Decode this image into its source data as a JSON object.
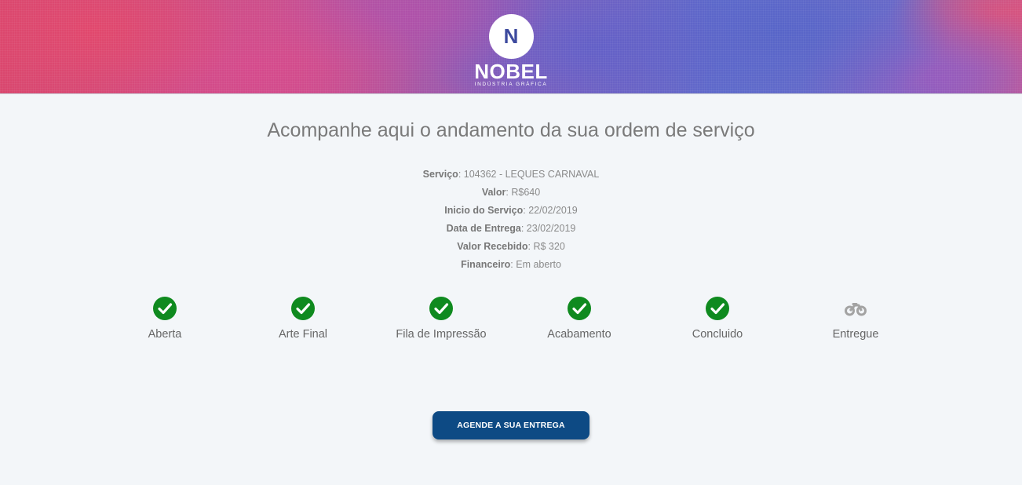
{
  "brand": {
    "logo_letter": "N",
    "name": "NOBEL",
    "subtitle": "INDÚSTRIA GRÁFICA"
  },
  "page_title": "Acompanhe aqui o andamento da sua ordem de serviço",
  "details": [
    {
      "label": "Serviço",
      "value": "104362 - LEQUES CARNAVAL"
    },
    {
      "label": "Valor",
      "value": "R$640"
    },
    {
      "label": "Inicio do Serviço",
      "value": "22/02/2019"
    },
    {
      "label": "Data de Entrega",
      "value": "23/02/2019"
    },
    {
      "label": "Valor Recebido",
      "value": "R$ 320"
    },
    {
      "label": "Financeiro",
      "value": "Em aberto"
    }
  ],
  "steps": [
    {
      "label": "Aberta",
      "icon": "check-circle-icon",
      "done": true
    },
    {
      "label": "Arte Final",
      "icon": "check-circle-icon",
      "done": true
    },
    {
      "label": "Fila de Impressão",
      "icon": "check-circle-icon",
      "done": true
    },
    {
      "label": "Acabamento",
      "icon": "check-circle-icon",
      "done": true
    },
    {
      "label": "Concluido",
      "icon": "check-circle-icon",
      "done": true
    },
    {
      "label": "Entregue",
      "icon": "motorcycle-icon",
      "done": false
    }
  ],
  "cta_label": "AGENDE A SUA ENTREGA",
  "colors": {
    "done": "#0f8a1f",
    "pending": "#a3a3a3",
    "button": "#0d4a84"
  }
}
